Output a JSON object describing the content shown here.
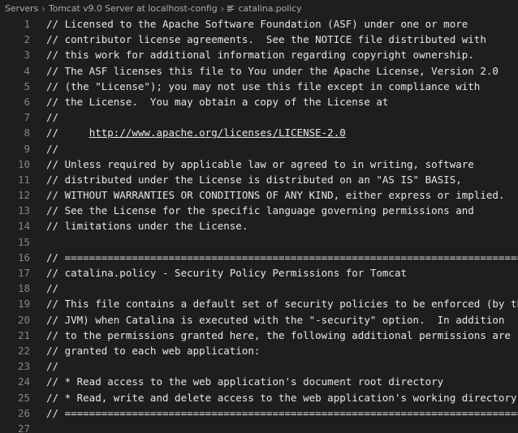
{
  "breadcrumb": {
    "items": [
      "Servers",
      "Tomcat v9.0 Server at localhost-config",
      "catalina.policy"
    ],
    "separator": "›",
    "file_icon": "lines-file-icon"
  },
  "colors": {
    "background": "#1e1e1e",
    "text": "#e6e6e6",
    "line_number": "#858585",
    "breadcrumb": "#a9a9a9"
  },
  "editor": {
    "lines": [
      {
        "num": "1",
        "text": "// Licensed to the Apache Software Foundation (ASF) under one or more"
      },
      {
        "num": "2",
        "text": "// contributor license agreements.  See the NOTICE file distributed with"
      },
      {
        "num": "3",
        "text": "// this work for additional information regarding copyright ownership."
      },
      {
        "num": "4",
        "text": "// The ASF licenses this file to You under the Apache License, Version 2.0"
      },
      {
        "num": "5",
        "text": "// (the \"License\"); you may not use this file except in compliance with"
      },
      {
        "num": "6",
        "text": "// the License.  You may obtain a copy of the License at"
      },
      {
        "num": "7",
        "text": "//"
      },
      {
        "num": "8",
        "prefix": "//     ",
        "link": "http://www.apache.org/licenses/LICENSE-2.0"
      },
      {
        "num": "9",
        "text": "//"
      },
      {
        "num": "10",
        "text": "// Unless required by applicable law or agreed to in writing, software"
      },
      {
        "num": "11",
        "text": "// distributed under the License is distributed on an \"AS IS\" BASIS,"
      },
      {
        "num": "12",
        "text": "// WITHOUT WARRANTIES OR CONDITIONS OF ANY KIND, either express or implied."
      },
      {
        "num": "13",
        "text": "// See the License for the specific language governing permissions and"
      },
      {
        "num": "14",
        "text": "// limitations under the License."
      },
      {
        "num": "15",
        "text": ""
      },
      {
        "num": "16",
        "text": "// ============================================================================"
      },
      {
        "num": "17",
        "text": "// catalina.policy - Security Policy Permissions for Tomcat"
      },
      {
        "num": "18",
        "text": "//"
      },
      {
        "num": "19",
        "text": "// This file contains a default set of security policies to be enforced (by the"
      },
      {
        "num": "20",
        "text": "// JVM) when Catalina is executed with the \"-security\" option.  In addition"
      },
      {
        "num": "21",
        "text": "// to the permissions granted here, the following additional permissions are"
      },
      {
        "num": "22",
        "text": "// granted to each web application:"
      },
      {
        "num": "23",
        "text": "//"
      },
      {
        "num": "24",
        "text": "// * Read access to the web application's document root directory"
      },
      {
        "num": "25",
        "text": "// * Read, write and delete access to the web application's working directory"
      },
      {
        "num": "26",
        "text": "// ============================================================================"
      },
      {
        "num": "27",
        "text": ""
      }
    ]
  }
}
